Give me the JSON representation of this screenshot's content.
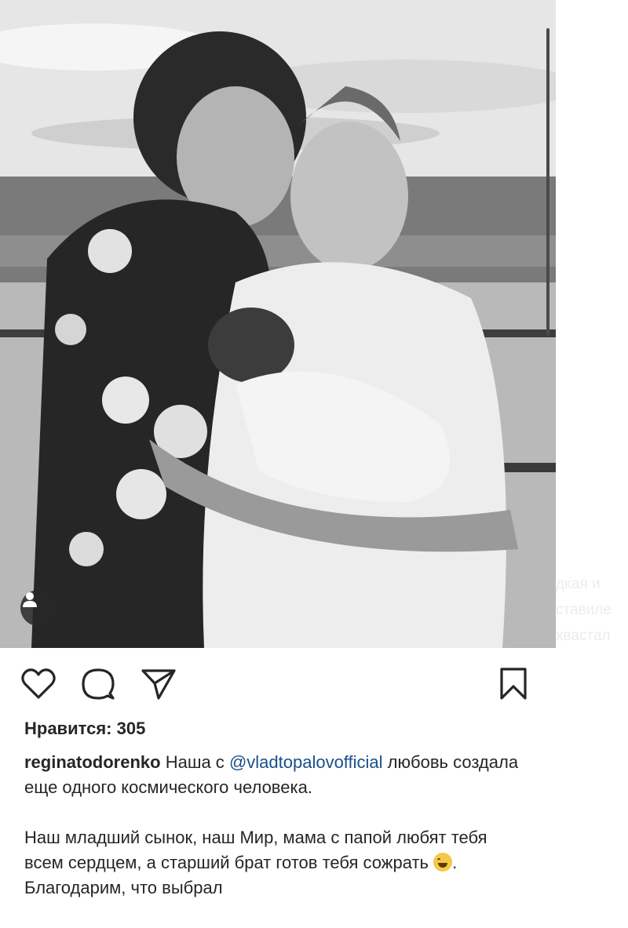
{
  "post": {
    "likes_label": "Нравится: 305",
    "caption": {
      "username": "reginatodorenko",
      "line1_text": " Наша с ",
      "mention": "@vladtopalovofficial",
      "line1_rest": " любовь создала еще одного космического человека.",
      "para2": "Наш младший сынок, наш Мир, мама с папой любят тебя всем сердцем, а старший брат готов тебя сожрать",
      "para2_rest": ". Благодарим, что выбрал"
    },
    "icons": {
      "like": "heart-icon",
      "comment": "comment-icon",
      "share": "send-icon",
      "save": "bookmark-icon",
      "tag": "user-tag-icon"
    }
  },
  "background_fragments": [
    "дкая и",
    "ставиле",
    "хвастал"
  ]
}
